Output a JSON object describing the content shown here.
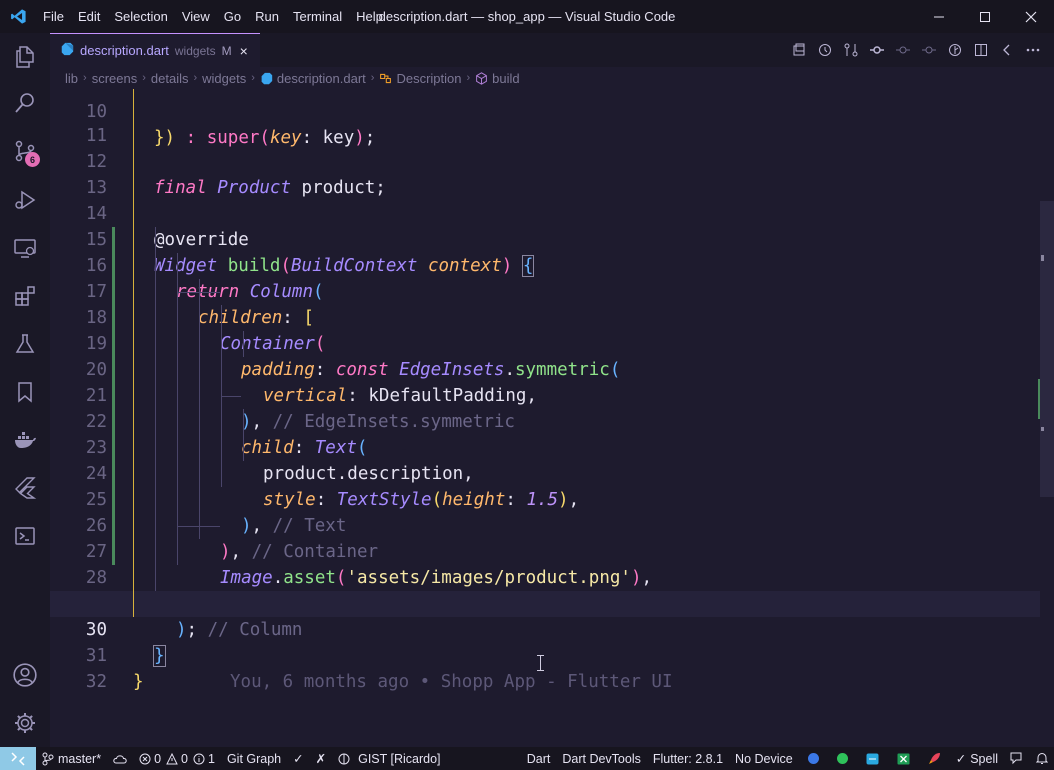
{
  "window": {
    "title": "description.dart — shop_app — Visual Studio Code",
    "menu": [
      "File",
      "Edit",
      "Selection",
      "View",
      "Go",
      "Run",
      "Terminal",
      "Help"
    ]
  },
  "activity_bar": {
    "items": [
      "explorer-icon",
      "search-icon",
      "source-control-icon",
      "run-debug-icon",
      "remote-explorer-icon",
      "extensions-icon",
      "testing-icon",
      "bookmarks-icon",
      "docker-icon",
      "flutter-icon",
      "powershell-icon",
      "account-icon",
      "settings-gear-icon"
    ],
    "source_control_badge": "6"
  },
  "tab": {
    "filename": "description.dart",
    "folder": "widgets",
    "modified": "M",
    "close": "×"
  },
  "breadcrumbs": [
    "lib",
    "screens",
    "details",
    "widgets",
    "description.dart",
    "Description",
    "build"
  ],
  "editor": {
    "current_line": 30,
    "blame_text": "You, 6 months ago • Shopp App - Flutter UI",
    "partial_top_line": "}) : super(key: key);"
  },
  "status_bar": {
    "branch": "master*",
    "errors": "0",
    "warnings": "0",
    "info": "1",
    "git_graph": "Git Graph",
    "check": "✓",
    "cross": "✗",
    "gist": "GIST [Ricardo]",
    "language": "Dart",
    "devtools": "Dart DevTools",
    "flutter": "Flutter: 2.8.1",
    "device": "No Device",
    "spell": "Spell"
  },
  "colors": {
    "background": "#1e1b2e",
    "accent": "#c592ff",
    "keyword": "#ff79c6",
    "class": "#a68bff",
    "function": "#90e38a",
    "parameter": "#ffb86c",
    "string": "#f6e8a6",
    "comment": "#6b6688"
  }
}
